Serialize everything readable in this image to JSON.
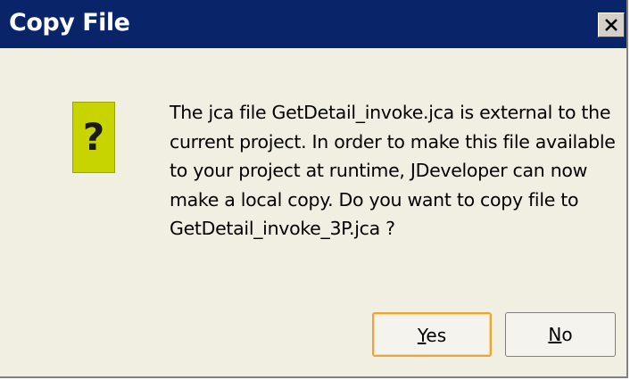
{
  "window": {
    "title": "Copy File",
    "close_label": "close"
  },
  "icon": {
    "name": "question-icon",
    "glyph": "?",
    "color": "#c8d400"
  },
  "message": {
    "lines": [
      "The jca file GetDetail_invoke.jca is external to the",
      "current project. In order to make this file available",
      "to your project at runtime, JDeveloper can now",
      "make a local copy. Do you want to copy file to",
      "GetDetail_invoke_3P.jca ?"
    ]
  },
  "buttons": {
    "yes": {
      "mnemonic": "Y",
      "rest": "es"
    },
    "no": {
      "mnemonic": "N",
      "rest": "o"
    }
  },
  "colors": {
    "titlebar": "#0a246a",
    "dialog_bg": "#f1efe2",
    "default_button_border": "#e8a53a"
  }
}
